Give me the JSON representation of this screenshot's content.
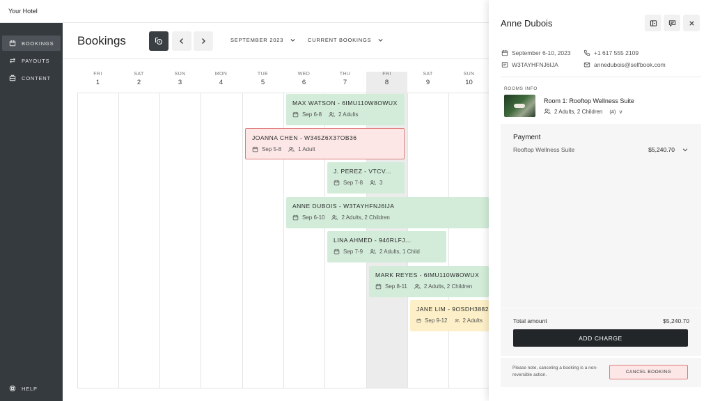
{
  "topbar": {
    "hotel_name": "Your Hotel"
  },
  "sidebar": {
    "items": [
      {
        "label": "BOOKINGS",
        "icon": "calendar-icon",
        "active": true
      },
      {
        "label": "PAYOUTS",
        "icon": "transfer-arrows-icon",
        "active": false
      },
      {
        "label": "CONTENT",
        "icon": "content-icon",
        "active": false
      }
    ],
    "help": {
      "label": "HELP",
      "icon": "help-icon"
    }
  },
  "header": {
    "title": "Bookings",
    "month_selector": "SEPTEMBER 2023",
    "filter_selector": "CURRENT BOOKINGS"
  },
  "calendar": {
    "days": [
      {
        "dow": "FRI",
        "num": "1"
      },
      {
        "dow": "SAT",
        "num": "2"
      },
      {
        "dow": "SUN",
        "num": "3"
      },
      {
        "dow": "MON",
        "num": "4"
      },
      {
        "dow": "TUE",
        "num": "5"
      },
      {
        "dow": "WED",
        "num": "6"
      },
      {
        "dow": "THU",
        "num": "7"
      },
      {
        "dow": "FRI",
        "num": "8"
      },
      {
        "dow": "SAT",
        "num": "9"
      },
      {
        "dow": "SUN",
        "num": "10"
      }
    ],
    "today_index": 7,
    "bookings": [
      {
        "name": "MAX WATSON - 6IMU110W8OWUX",
        "dates": "Sep 6-8",
        "guests": "2 Adults",
        "status": "confirmed"
      },
      {
        "name": "JOANNA CHEN - W345Z6X37OB36",
        "dates": "Sep 5-8",
        "guests": "1 Adult",
        "status": "cancelled"
      },
      {
        "name": "J. PEREZ - VTCV...",
        "dates": "Sep 7-8",
        "guests": "3",
        "status": "confirmed"
      },
      {
        "name": "ANNE DUBOIS - W3TAYHFNJ6IJA",
        "dates": "Sep 6-10",
        "guests": "2 Adults, 2 Children",
        "status": "confirmed"
      },
      {
        "name": "LINA AHMED - 946RLFJ...",
        "dates": "Sep 7-9",
        "guests": "2 Adults, 1 Child",
        "status": "confirmed"
      },
      {
        "name": "MARK REYES - 6IMU110W8OWUX",
        "dates": "Sep 8-11",
        "guests": "2 Adults, 2 Children",
        "status": "confirmed"
      },
      {
        "name": "JANE LIM - 9OSDH3882",
        "dates": "Sep 9-12",
        "guests": "2 Adults",
        "status": "pending"
      }
    ]
  },
  "colors": {
    "confirmed": "#d2ecd9",
    "cancelled": "#fce6e6",
    "pending": "#fdf0c8",
    "sidebar": "#353a3e",
    "primary_button": "#222629"
  },
  "panel": {
    "guest_name": "Anne Dubois",
    "dates": "September 6-10, 2023",
    "phone": "+1 617 555 2109",
    "booking_code": "W3TAYHFNJ6IJA",
    "email": "annedubois@selfbook.com",
    "rooms_label": "ROOMS INFO",
    "room_name": "Room 1: Rooftop Wellness Suite",
    "room_guests": "2 Adults, 2 Children",
    "room_extra": "v",
    "payment_title": "Payment",
    "payment_item": "Rooftop Wellness Suite",
    "payment_amount": "$5,240.70",
    "total_label": "Total amount",
    "total_value": "$5,240.70",
    "add_charge": "ADD CHARGE",
    "cancel_note": "Please note, canceling a booking is a non-reversible action.",
    "cancel_button": "CANCEL BOOKING"
  }
}
